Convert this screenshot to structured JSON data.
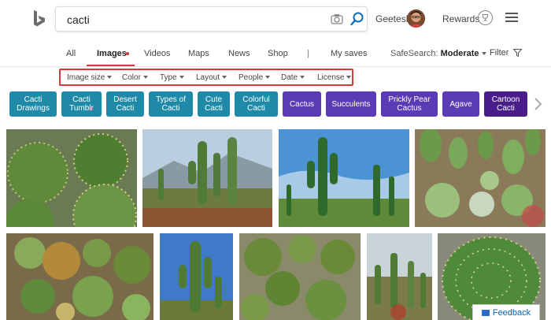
{
  "search": {
    "query": "cacti"
  },
  "user": {
    "name": "Geetesh"
  },
  "header": {
    "rewards": "Rewards"
  },
  "nav": {
    "tabs": [
      {
        "label": "All"
      },
      {
        "label": "Images"
      },
      {
        "label": "Videos"
      },
      {
        "label": "Maps"
      },
      {
        "label": "News"
      },
      {
        "label": "Shop"
      },
      {
        "label": "My saves"
      }
    ],
    "divider": "|",
    "safesearch_label": "SafeSearch:",
    "safesearch_value": "Moderate",
    "filter_label": "Filter"
  },
  "filters": [
    "Image size",
    "Color",
    "Type",
    "Layout",
    "People",
    "Date",
    "License"
  ],
  "chips": [
    {
      "l1": "Cacti",
      "l2": "Drawings",
      "color": "#1e8aa8"
    },
    {
      "l1": "Cacti",
      "l2": "Tumblr",
      "color": "#1e8aa8"
    },
    {
      "l1": "Desert",
      "l2": "Cacti",
      "color": "#1e8aa8"
    },
    {
      "l1": "Types of",
      "l2": "Cacti",
      "color": "#1e8aa8"
    },
    {
      "l1": "Cute",
      "l2": "Cacti",
      "color": "#1e8aa8"
    },
    {
      "l1": "Colorful",
      "l2": "Cacti",
      "color": "#1e8aa8"
    },
    {
      "l1": "Cactus",
      "l2": "",
      "color": "#5b3bb5"
    },
    {
      "l1": "Succulents",
      "l2": "",
      "color": "#5b3bb5"
    },
    {
      "l1": "Prickly Pear",
      "l2": "Cactus",
      "color": "#5b3bb5"
    },
    {
      "l1": "Agave",
      "l2": "",
      "color": "#5b3bb5"
    },
    {
      "l1": "Cartoon",
      "l2": "Cacti",
      "color": "#4a1e8a"
    }
  ],
  "feedback": "Feedback",
  "colors": {
    "accent_red": "#d53540",
    "brand_blue": "#0060c0"
  }
}
